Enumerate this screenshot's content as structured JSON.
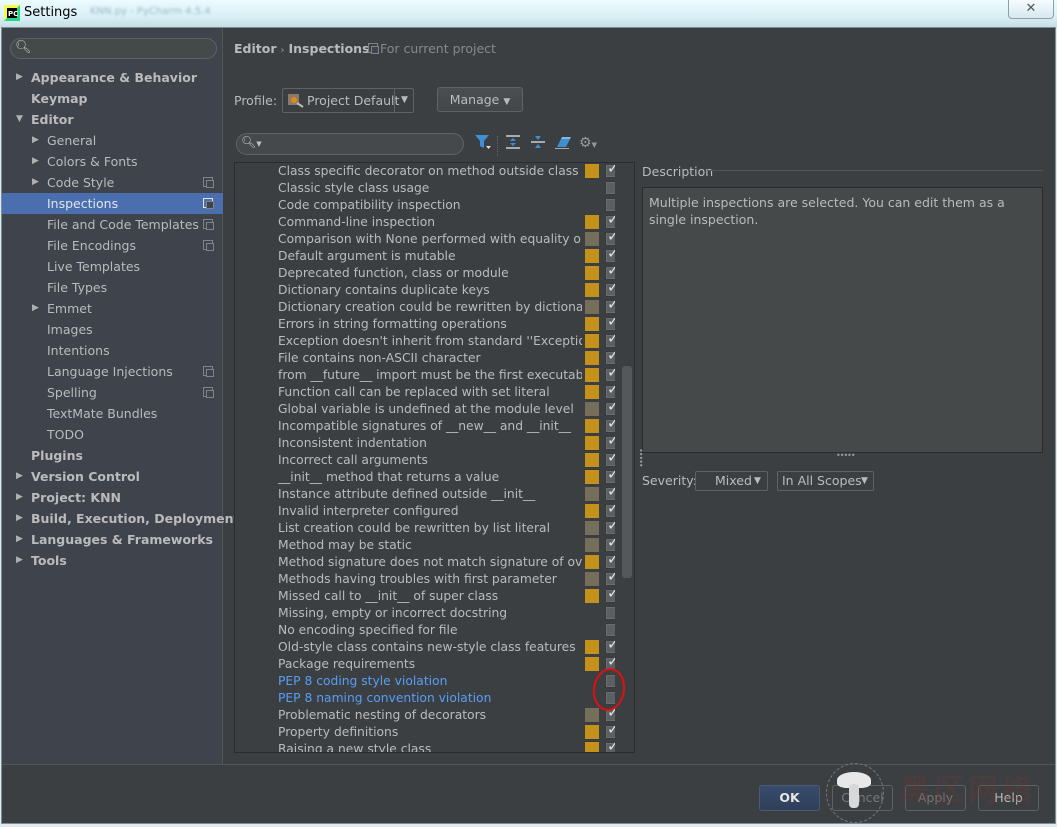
{
  "window": {
    "title": "Settings",
    "close_glyph": "✕",
    "background_blurred_text": "KNN.py - PyCharm 4.5.4"
  },
  "sidebar": {
    "search_placeholder": "",
    "items": [
      {
        "label": "Appearance & Behavior",
        "level": 0,
        "bold": true,
        "arrow": "right",
        "copy_icon": false
      },
      {
        "label": "Keymap",
        "level": 0,
        "bold": true,
        "arrow": "none",
        "copy_icon": false
      },
      {
        "label": "Editor",
        "level": 0,
        "bold": true,
        "arrow": "down",
        "copy_icon": false
      },
      {
        "label": "General",
        "level": 1,
        "bold": false,
        "arrow": "right",
        "copy_icon": false
      },
      {
        "label": "Colors & Fonts",
        "level": 1,
        "bold": false,
        "arrow": "right",
        "copy_icon": false
      },
      {
        "label": "Code Style",
        "level": 1,
        "bold": false,
        "arrow": "right",
        "copy_icon": true
      },
      {
        "label": "Inspections",
        "level": 1,
        "bold": false,
        "arrow": "none",
        "copy_icon": true,
        "selected": true
      },
      {
        "label": "File and Code Templates",
        "level": 1,
        "bold": false,
        "arrow": "none",
        "copy_icon": true
      },
      {
        "label": "File Encodings",
        "level": 1,
        "bold": false,
        "arrow": "none",
        "copy_icon": true
      },
      {
        "label": "Live Templates",
        "level": 1,
        "bold": false,
        "arrow": "none",
        "copy_icon": false
      },
      {
        "label": "File Types",
        "level": 1,
        "bold": false,
        "arrow": "none",
        "copy_icon": false
      },
      {
        "label": "Emmet",
        "level": 1,
        "bold": false,
        "arrow": "right",
        "copy_icon": false
      },
      {
        "label": "Images",
        "level": 1,
        "bold": false,
        "arrow": "none",
        "copy_icon": false
      },
      {
        "label": "Intentions",
        "level": 1,
        "bold": false,
        "arrow": "none",
        "copy_icon": false
      },
      {
        "label": "Language Injections",
        "level": 1,
        "bold": false,
        "arrow": "none",
        "copy_icon": true
      },
      {
        "label": "Spelling",
        "level": 1,
        "bold": false,
        "arrow": "none",
        "copy_icon": true
      },
      {
        "label": "TextMate Bundles",
        "level": 1,
        "bold": false,
        "arrow": "none",
        "copy_icon": false
      },
      {
        "label": "TODO",
        "level": 1,
        "bold": false,
        "arrow": "none",
        "copy_icon": false
      },
      {
        "label": "Plugins",
        "level": 0,
        "bold": true,
        "arrow": "none",
        "copy_icon": false
      },
      {
        "label": "Version Control",
        "level": 0,
        "bold": true,
        "arrow": "right",
        "copy_icon": false
      },
      {
        "label": "Project: KNN",
        "level": 0,
        "bold": true,
        "arrow": "right",
        "copy_icon": false
      },
      {
        "label": "Build, Execution, Deployment",
        "level": 0,
        "bold": true,
        "arrow": "right",
        "copy_icon": false
      },
      {
        "label": "Languages & Frameworks",
        "level": 0,
        "bold": true,
        "arrow": "right",
        "copy_icon": false
      },
      {
        "label": "Tools",
        "level": 0,
        "bold": true,
        "arrow": "right",
        "copy_icon": false
      }
    ]
  },
  "header": {
    "breadcrumb": [
      "Editor",
      "Inspections"
    ],
    "breadcrumb_sep": "›",
    "scope_note": "For current project"
  },
  "profile": {
    "label": "Profile:",
    "value": "Project Default",
    "manage_label": "Manage"
  },
  "toolbar": {
    "search_placeholder": "",
    "icons": [
      "filter-icon",
      "expand-all-icon",
      "collapse-all-icon",
      "reset-eraser-icon",
      "settings-gear-icon"
    ]
  },
  "colors": {
    "warning": "#c4921a",
    "weak_warning": "#756e5b",
    "selection": "#4b6eaf",
    "link_blue": "#589df6",
    "annotation_red": "#e01010"
  },
  "inspections": [
    {
      "name": "Class specific decorator on method outside class",
      "severity": "warning",
      "checked": true
    },
    {
      "name": "Classic style class usage",
      "severity": "none",
      "checked": false
    },
    {
      "name": "Code compatibility inspection",
      "severity": "none",
      "checked": false
    },
    {
      "name": "Command-line inspection",
      "severity": "warning",
      "checked": true
    },
    {
      "name": "Comparison with None performed with equality operators",
      "severity": "weak",
      "checked": true
    },
    {
      "name": "Default argument is mutable",
      "severity": "warning",
      "checked": true
    },
    {
      "name": "Deprecated function, class or module",
      "severity": "warning",
      "checked": true
    },
    {
      "name": "Dictionary contains duplicate keys",
      "severity": "warning",
      "checked": true
    },
    {
      "name": "Dictionary creation could be rewritten by dictionary literal",
      "severity": "weak",
      "checked": true
    },
    {
      "name": "Errors in string formatting operations",
      "severity": "warning",
      "checked": true
    },
    {
      "name": "Exception doesn't inherit from standard ''Exception'' class",
      "severity": "warning",
      "checked": true
    },
    {
      "name": "File contains non-ASCII character",
      "severity": "warning",
      "checked": true
    },
    {
      "name": "from __future__ import must be the first executable statement",
      "severity": "warning",
      "checked": true
    },
    {
      "name": "Function call can be replaced with set literal",
      "severity": "warning",
      "checked": true
    },
    {
      "name": "Global variable is undefined at the module level",
      "severity": "weak",
      "checked": true
    },
    {
      "name": "Incompatible signatures of __new__ and __init__",
      "severity": "warning",
      "checked": true
    },
    {
      "name": "Inconsistent indentation",
      "severity": "warning",
      "checked": true
    },
    {
      "name": "Incorrect call arguments",
      "severity": "warning",
      "checked": true
    },
    {
      "name": "__init__ method that returns a value",
      "severity": "warning",
      "checked": true
    },
    {
      "name": "Instance attribute defined outside __init__",
      "severity": "weak",
      "checked": true
    },
    {
      "name": "Invalid interpreter configured",
      "severity": "warning",
      "checked": true
    },
    {
      "name": "List creation could be rewritten by list literal",
      "severity": "weak",
      "checked": true
    },
    {
      "name": "Method may be static",
      "severity": "weak",
      "checked": true
    },
    {
      "name": "Method signature does not match signature of overridden method",
      "severity": "warning",
      "checked": true
    },
    {
      "name": "Methods having troubles with first parameter",
      "severity": "weak",
      "checked": true
    },
    {
      "name": "Missed call to __init__ of super class",
      "severity": "warning",
      "checked": true
    },
    {
      "name": "Missing, empty or incorrect docstring",
      "severity": "none",
      "checked": false
    },
    {
      "name": "No encoding specified for file",
      "severity": "none",
      "checked": false
    },
    {
      "name": "Old-style class contains new-style class features",
      "severity": "warning",
      "checked": true
    },
    {
      "name": "Package requirements",
      "severity": "warning",
      "checked": true
    },
    {
      "name": "PEP 8 coding style violation",
      "severity": "none",
      "checked": false,
      "highlight": true
    },
    {
      "name": "PEP 8 naming convention violation",
      "severity": "none",
      "checked": false,
      "highlight": true
    },
    {
      "name": "Problematic nesting of decorators",
      "severity": "weak",
      "checked": true
    },
    {
      "name": "Property definitions",
      "severity": "warning",
      "checked": true
    },
    {
      "name": "Raising a new style class",
      "severity": "warning",
      "checked": true
    }
  ],
  "description": {
    "title": "Description",
    "text": "Multiple inspections are selected. You can edit them as a single inspection."
  },
  "severity": {
    "label": "Severity:",
    "value": "Mixed",
    "scope_value": "In All Scopes"
  },
  "footer": {
    "ok": "OK",
    "cancel": "Cancel",
    "apply": "Apply",
    "help": "Help"
  },
  "watermark_text": "黑区网络"
}
